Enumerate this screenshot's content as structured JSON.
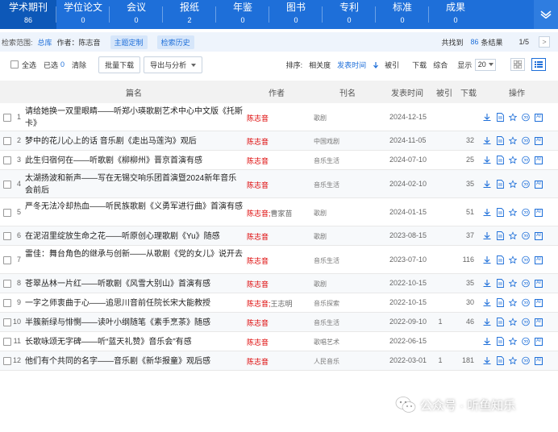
{
  "tabs": [
    {
      "label": "学术期刊",
      "count": "86",
      "active": true
    },
    {
      "label": "学位论文",
      "count": "0"
    },
    {
      "label": "会议",
      "count": "0"
    },
    {
      "label": "报纸",
      "count": "2"
    },
    {
      "label": "年鉴",
      "count": "0"
    },
    {
      "label": "图书",
      "count": "0"
    },
    {
      "label": "专利",
      "count": "0"
    },
    {
      "label": "标准",
      "count": "0"
    },
    {
      "label": "成果",
      "count": "0"
    }
  ],
  "scope": {
    "label": "检索范围:",
    "db": "总库",
    "author_label": "作者：陈志音",
    "chip1": "主题定制",
    "chip2": "检索历史",
    "found_prefix": "共找到",
    "found_count": "86",
    "found_suffix": "条结果",
    "page": "1/5",
    "next": ">"
  },
  "toolbar": {
    "select_all": "全选",
    "selected_label": "已选",
    "selected_count": "0",
    "clear": "清除",
    "batch_download": "批量下载",
    "export": "导出与分析",
    "sort_label": "排序:",
    "sort_relevance": "相关度",
    "sort_date": "发表时间",
    "sort_cite": "被引",
    "sort_download": "下载",
    "sort_overall": "综合",
    "show_label": "显示",
    "show_value": "20"
  },
  "header": {
    "title": "篇名",
    "author": "作者",
    "source": "刊名",
    "date": "发表时间",
    "cite": "被引",
    "download": "下载",
    "ops": "操作"
  },
  "rows": [
    {
      "no": "1",
      "title": "请给她换一双里眼睛——听郑小瑛歌剧艺术中心中文版《托斯卡》",
      "author": "陈志音",
      "coauthor": "",
      "source": "歌剧",
      "date": "2024-12-15",
      "cite": "",
      "download": ""
    },
    {
      "no": "2",
      "title": "梦中的花儿心上的话 音乐剧《走出马莲沟》观后",
      "author": "陈志音",
      "coauthor": "",
      "source": "中国戏剧",
      "date": "2024-11-05",
      "cite": "",
      "download": "32"
    },
    {
      "no": "3",
      "title": "此生归宿何在——听歌剧《柳柳州》晋京首演有感",
      "author": "陈志音",
      "coauthor": "",
      "source": "音乐生活",
      "date": "2024-07-10",
      "cite": "",
      "download": "25"
    },
    {
      "no": "4",
      "title": "太湖扬波和新声——写在无锡交响乐团首演暨2024新年音乐会前后",
      "author": "陈志音",
      "coauthor": "",
      "source": "音乐生活",
      "date": "2024-02-10",
      "cite": "",
      "download": "35"
    },
    {
      "no": "5",
      "title": "严冬无法冷却热血——听民族歌剧《义勇军进行曲》首演有感",
      "author": "陈志音;",
      "coauthor": "曹家苗",
      "source": "歌剧",
      "date": "2024-01-15",
      "cite": "",
      "download": "51"
    },
    {
      "no": "6",
      "title": "在泥沼里绽放生命之花——听原创心理歌剧《Yu》随感",
      "author": "陈志音",
      "coauthor": "",
      "source": "歌剧",
      "date": "2023-08-15",
      "cite": "",
      "download": "37"
    },
    {
      "no": "7",
      "title": "雷佳：舞台角色的继承与创新——从歌剧《党的女儿》说开去",
      "author": "陈志音",
      "coauthor": "",
      "source": "音乐生活",
      "date": "2023-07-10",
      "cite": "",
      "download": "116"
    },
    {
      "no": "8",
      "title": "苍翠丛林一片红——听歌剧《风雪大别山》首演有感",
      "author": "陈志音",
      "coauthor": "",
      "source": "歌剧",
      "date": "2022-10-15",
      "cite": "",
      "download": "35"
    },
    {
      "no": "9",
      "title": "一字之师衷曲于心——追思川音前任院长宋大能教授",
      "author": "陈志音;",
      "coauthor": "王志明",
      "source": "音乐探索",
      "date": "2022-10-15",
      "cite": "",
      "download": "30"
    },
    {
      "no": "10",
      "title": "半簇新绿与悱惻——读叶小纲随笔《素手烹茶》随感",
      "author": "陈志音",
      "coauthor": "",
      "source": "音乐生活",
      "date": "2022-09-10",
      "cite": "1",
      "download": "46"
    },
    {
      "no": "11",
      "title": "长歌咏颂无字碑——听“蓝天礼赞》音乐会”有感",
      "author": "陈志音",
      "coauthor": "",
      "source": "歌唱艺术",
      "date": "2022-06-15",
      "cite": "",
      "download": ""
    },
    {
      "no": "12",
      "title": "他们有个共同的名字——音乐剧《新华报童》观后感",
      "author": "陈志音",
      "coauthor": "",
      "source": "人民音乐",
      "date": "2022-03-01",
      "cite": "1",
      "download": "181"
    }
  ],
  "watermark": {
    "text": "公众号 · 听鱼知乐"
  },
  "colors": {
    "brand": "#1e6fd9",
    "author": "#dd0000"
  }
}
